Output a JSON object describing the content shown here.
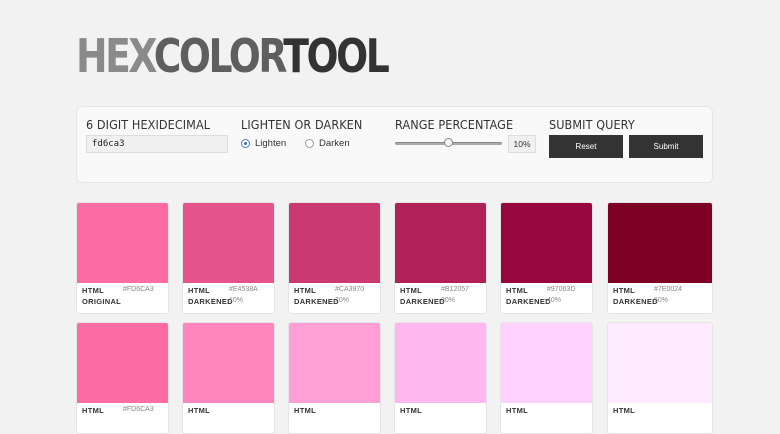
{
  "logo": {
    "part1": "HEX",
    "part2": "COLOR",
    "part3": "TOOL"
  },
  "form": {
    "hex_title": "6 DIGIT HEXIDECIMAL",
    "hex_value": "fd6ca3",
    "mode_title": "LIGHTEN OR DARKEN",
    "lighten_label": "Lighten",
    "darken_label": "Darken",
    "selected_mode": "lighten",
    "range_title": "RANGE PERCENTAGE",
    "range_value_percent": 10,
    "range_display": "10%",
    "submit_title": "SUBMIT QUERY",
    "reset_label": "Reset",
    "submit_label": "Submit"
  },
  "colors": {
    "accent_radio": "#3a6fc0",
    "button_bg": "#333333"
  },
  "swatches_row1": [
    {
      "color": "#FD6CA3",
      "label1": "HTML",
      "label2": "ORIGINAL",
      "hex": "#FD6CA3",
      "pct": ""
    },
    {
      "color": "#E4538A",
      "label1": "HTML",
      "label2": "DARKENED",
      "hex": "#E4538A",
      "pct": "10%"
    },
    {
      "color": "#CA3970",
      "label1": "HTML",
      "label2": "DARKENED",
      "hex": "#CA3970",
      "pct": "20%"
    },
    {
      "color": "#B12057",
      "label1": "HTML",
      "label2": "DARKENED",
      "hex": "#B12057",
      "pct": "30%"
    },
    {
      "color": "#97063D",
      "label1": "HTML",
      "label2": "DARKENED",
      "hex": "#97063D",
      "pct": "40%"
    },
    {
      "color": "#7E0024",
      "label1": "HTML",
      "label2": "DARKENED",
      "hex": "#7E0024",
      "pct": "50%"
    }
  ],
  "swatches_row2": [
    {
      "color": "#FD6CA3",
      "label1": "HTML",
      "label2": "",
      "hex": "#FD6CA3",
      "pct": ""
    },
    {
      "color": "#FF85BC",
      "label1": "HTML",
      "label2": "",
      "hex": "",
      "pct": ""
    },
    {
      "color": "#FF9FD6",
      "label1": "HTML",
      "label2": "",
      "hex": "",
      "pct": ""
    },
    {
      "color": "#FFB8EF",
      "label1": "HTML",
      "label2": "",
      "hex": "",
      "pct": ""
    },
    {
      "color": "#FFD2FF",
      "label1": "HTML",
      "label2": "",
      "hex": "",
      "pct": ""
    },
    {
      "color": "#FFEBFF",
      "label1": "HTML",
      "label2": "",
      "hex": "",
      "pct": ""
    }
  ]
}
